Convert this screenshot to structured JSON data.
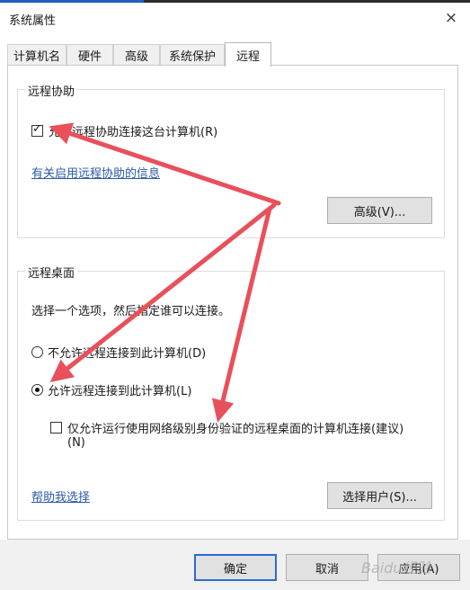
{
  "window": {
    "title": "系统属性",
    "close_icon": "×"
  },
  "tabs": [
    {
      "label": "计算机名",
      "active": false
    },
    {
      "label": "硬件",
      "active": false
    },
    {
      "label": "高级",
      "active": false
    },
    {
      "label": "系统保护",
      "active": false
    },
    {
      "label": "远程",
      "active": true
    }
  ],
  "remote_assistance": {
    "title": "远程协助",
    "allow_label": "允许远程协助连接这台计算机(R)",
    "allow_checked": true,
    "info_link": "有关启用远程协助的信息",
    "advanced_button": "高级(V)..."
  },
  "remote_desktop": {
    "title": "远程桌面",
    "instruction": "选择一个选项，然后指定谁可以连接。",
    "option_deny": "不允许远程连接到此计算机(D)",
    "option_allow": "允许远程连接到此计算机(L)",
    "selected": "allow",
    "nla_label_line1": "仅允许运行使用网络级别身份验证的远程桌面的计算机连接(建议)",
    "nla_label_line2": "(N)",
    "nla_checked": false,
    "help_link": "帮助我选择",
    "select_users_button": "选择用户(S)..."
  },
  "footer": {
    "ok": "确定",
    "cancel": "取消",
    "apply": "应用(A)"
  },
  "watermark": "Baidu经验",
  "colors": {
    "arrow": "#e8505b",
    "link": "#2a5aa8",
    "accent": "#2a6bd3"
  }
}
